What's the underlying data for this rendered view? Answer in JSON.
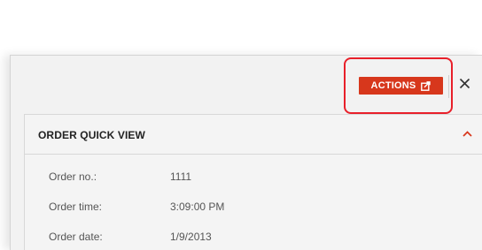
{
  "toolbar": {
    "actions_label": "ACTIONS",
    "actions_icon": "external-link-icon",
    "close_icon": "close-icon"
  },
  "quick_view": {
    "title": "ORDER QUICK VIEW",
    "collapse_icon": "chevron-up-icon",
    "fields": [
      {
        "label": "Order no.:",
        "value": "1111"
      },
      {
        "label": "Order time:",
        "value": "3:09:00 PM"
      },
      {
        "label": "Order date:",
        "value": "1/9/2013"
      }
    ]
  },
  "colors": {
    "accent": "#d7371c",
    "highlight": "#e8202a"
  }
}
